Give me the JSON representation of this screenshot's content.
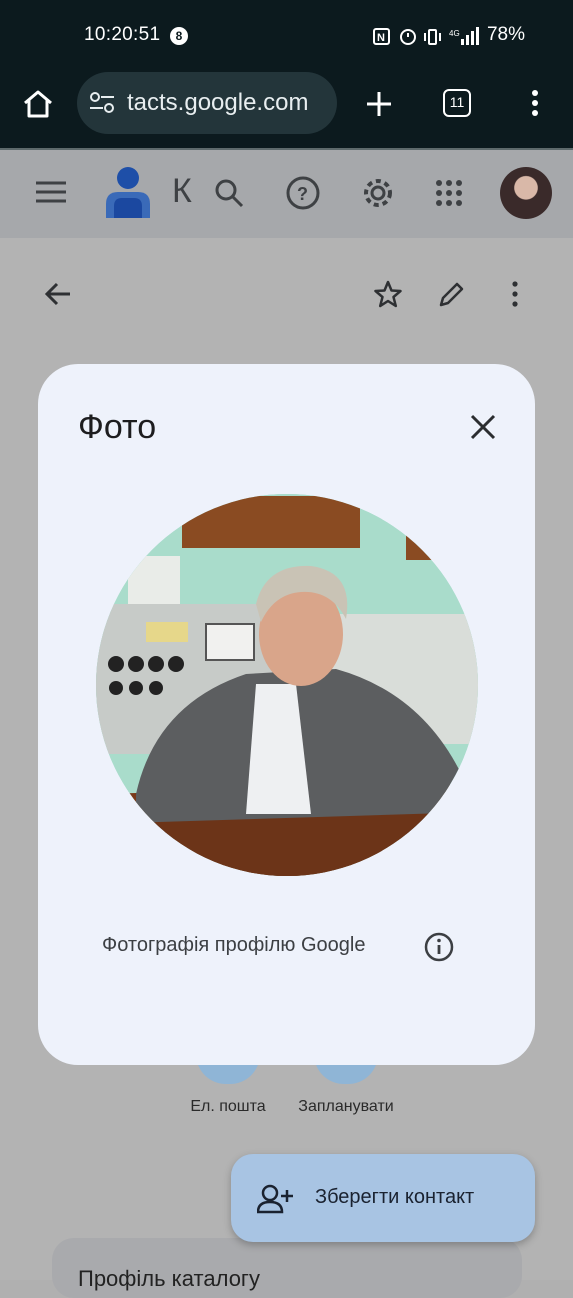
{
  "status_bar": {
    "time": "10:20:51",
    "notification_count": "8",
    "battery": "78%"
  },
  "browser": {
    "url": "tacts.google.com",
    "tabs_count": "11"
  },
  "app_header": {
    "title_partial": "К"
  },
  "dialog": {
    "title": "Фото",
    "caption": "Фотографія профілю Google"
  },
  "actions": {
    "email_label": "Ел. пошта",
    "schedule_label": "Запланувати"
  },
  "fab": {
    "label": "Зберегти контакт"
  },
  "bottom_card": {
    "title": "Профіль каталогу"
  },
  "colors": {
    "dialog_bg": "#eef2fb",
    "fab_bg": "#a8c4e3",
    "status_bar_bg": "#0c1a1e"
  }
}
